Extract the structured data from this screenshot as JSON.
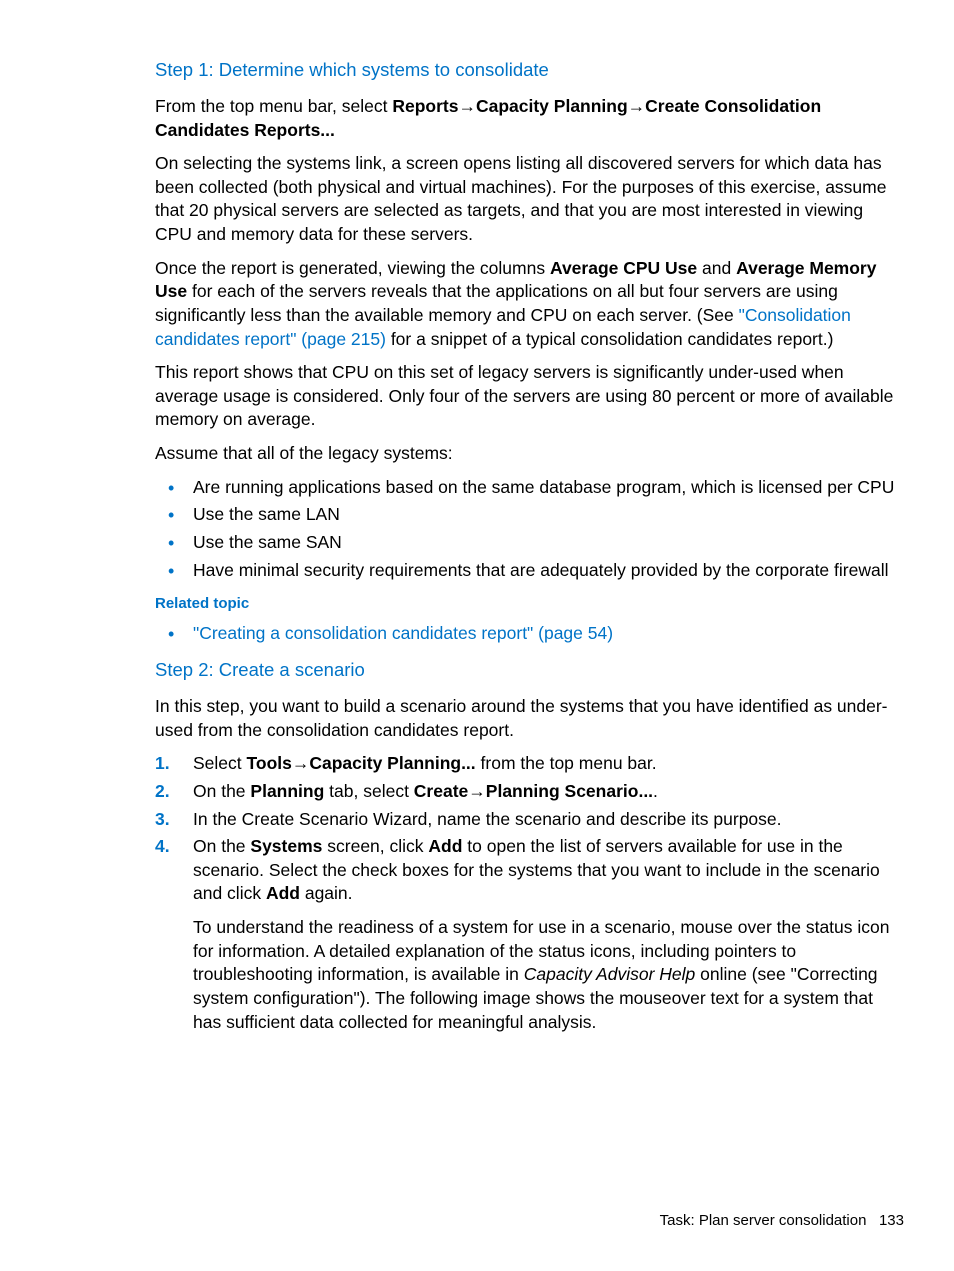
{
  "step1": {
    "heading": "Step 1: Determine which systems to consolidate",
    "p1_lead": "From the top menu bar, select ",
    "p1_bold1": "Reports",
    "p1_bold2": "Capacity Planning",
    "p1_bold3": "Create Consolidation Candidates Reports...",
    "p2": "On selecting the systems link, a screen opens listing all discovered servers for which data has been collected (both physical and virtual machines). For the purposes of this exercise, assume that 20 physical servers are selected as targets, and that you are most interested in viewing CPU and memory data for these servers.",
    "p3_a": "Once the report is generated, viewing the columns ",
    "p3_b1": "Average CPU Use",
    "p3_b": " and ",
    "p3_b2": "Average Memory Use",
    "p3_c": " for each of the servers reveals that the applications on all but four servers are using significantly less than the available memory and CPU on each server. (See ",
    "p3_link": "\"Consolidation candidates report\" (page 215)",
    "p3_d": " for a snippet of a typical consolidation candidates report.)",
    "p4": "This report shows that CPU on this set of legacy servers is significantly under-used when average usage is considered. Only four of the servers are using 80 percent or more of available memory on average.",
    "p5": "Assume that all of the legacy systems:",
    "bullets": [
      "Are running applications based on the same database program, which is licensed per CPU",
      "Use the same LAN",
      "Use the same SAN",
      "Have minimal security requirements that are adequately provided by the corporate firewall"
    ],
    "related_label": "Related topic",
    "related_link": "\"Creating a consolidation candidates report\" (page 54)"
  },
  "step2": {
    "heading": "Step 2: Create a scenario",
    "p1": "In this step, you want to build a scenario around the systems that you have identified as under-used from the consolidation candidates report.",
    "li1_a": "Select ",
    "li1_b1": "Tools",
    "li1_b2": "Capacity Planning...",
    "li1_c": " from the top menu bar.",
    "li2_a": "On the ",
    "li2_b1": "Planning",
    "li2_b": " tab, select ",
    "li2_b2": "Create",
    "li2_b3": "Planning Scenario...",
    "li2_c": ".",
    "li3": "In the Create Scenario Wizard, name the scenario and describe its purpose.",
    "li4_a": "On the ",
    "li4_b1": "Systems",
    "li4_b": " screen, click ",
    "li4_b2": "Add",
    "li4_c": " to open the list of servers available for use in the scenario. Select the check boxes for the systems that you want to include in the scenario and click ",
    "li4_b3": "Add",
    "li4_d": " again.",
    "li4_sub_a": "To understand the readiness of a system for use in a scenario, mouse over the status icon for information. A detailed explanation of the status icons, including pointers to troubleshooting information, is available in ",
    "li4_sub_em": "Capacity Advisor Help",
    "li4_sub_b": " online (see \"Correcting system configuration\"). The following image shows the mouseover text for a system that has sufficient data collected for meaningful analysis."
  },
  "footer": {
    "text": "Task: Plan server consolidation",
    "page": "133"
  },
  "arrow": "→"
}
